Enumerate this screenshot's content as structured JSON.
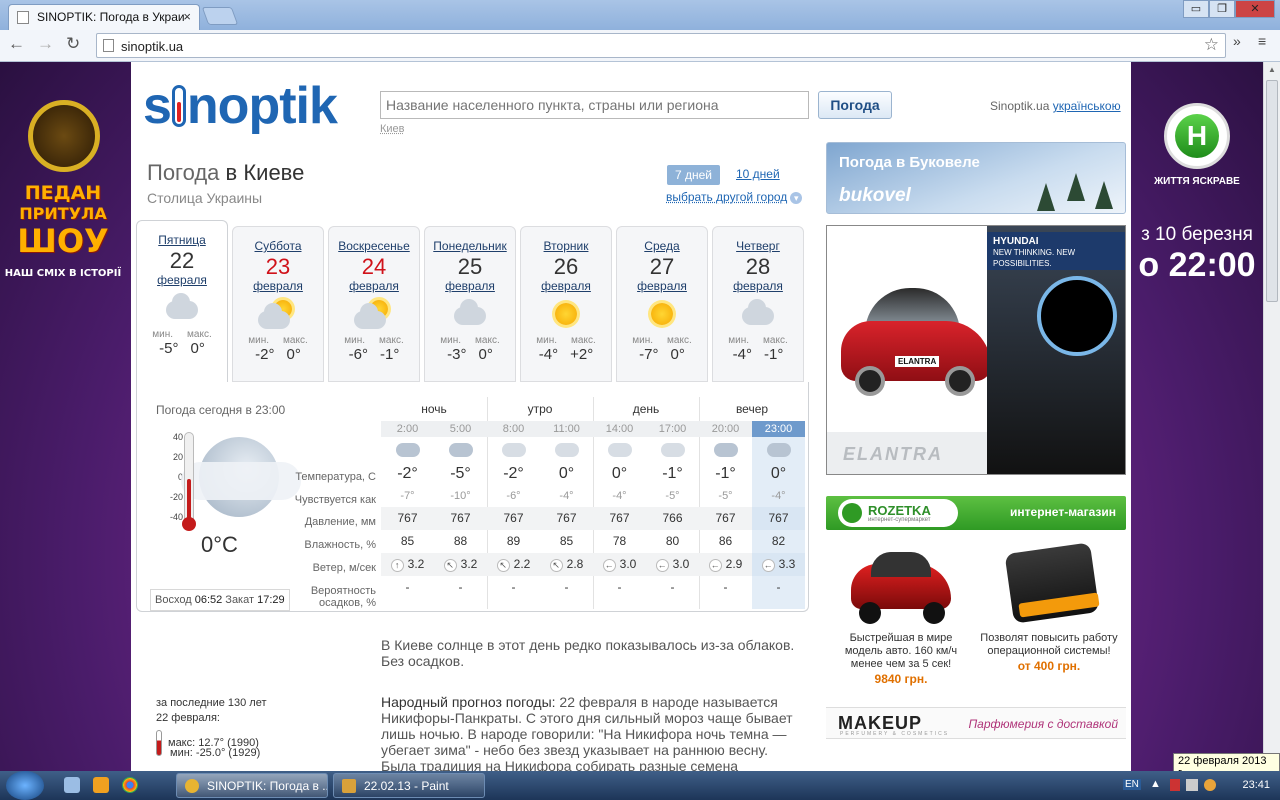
{
  "browser": {
    "tab_title": "SINOPTIK: Погода в Украи",
    "url": "sinoptik.ua",
    "window_buttons": [
      "▭",
      "❐",
      "✕"
    ]
  },
  "left_ad": {
    "title": "ПЕДАН ПРИТУЛА ШОУ",
    "line1": "ПЕДАН",
    "line2": "ПРИТУЛА",
    "line3": "ШОУ",
    "tagline": "НАШ СМІХ В ІСТОРІЇ"
  },
  "header": {
    "logo": "sinoptik",
    "search_placeholder": "Название населенного пункта, страны или региона",
    "search_button": "Погода",
    "search_hint": "Киев",
    "site_name": "Sinoptik.ua",
    "lang_link": "українською"
  },
  "title": {
    "lead": "Погода",
    "city": "в Киеве",
    "subtitle": "Столица Украины",
    "days7": "7 дней",
    "days10": "10 дней",
    "other_city": "выбрать другой город"
  },
  "days": [
    {
      "name": "Пятница",
      "day": "22",
      "month": "февраля",
      "icon": "cloudy",
      "min": "-5°",
      "max": "0°",
      "red": false
    },
    {
      "name": "Суббота",
      "day": "23",
      "month": "февраля",
      "icon": "sun-cloud",
      "min": "-2°",
      "max": "0°",
      "red": true
    },
    {
      "name": "Воскресенье",
      "day": "24",
      "month": "февраля",
      "icon": "sun-cloud",
      "min": "-6°",
      "max": "-1°",
      "red": true
    },
    {
      "name": "Понедельник",
      "day": "25",
      "month": "февраля",
      "icon": "cloudy",
      "min": "-3°",
      "max": "0°",
      "red": false
    },
    {
      "name": "Вторник",
      "day": "26",
      "month": "февраля",
      "icon": "sun",
      "min": "-4°",
      "max": "+2°",
      "red": false
    },
    {
      "name": "Среда",
      "day": "27",
      "month": "февраля",
      "icon": "sun",
      "min": "-7°",
      "max": "0°",
      "red": false
    },
    {
      "name": "Четверг",
      "day": "28",
      "month": "февраля",
      "icon": "cloudy",
      "min": "-4°",
      "max": "-1°",
      "red": false
    }
  ],
  "min_label": "мин.",
  "max_label": "макс.",
  "now": {
    "label": "Погода сегодня в 23:00",
    "temp": "0°C",
    "scale": [
      "40",
      "20",
      "0",
      "-20",
      "-40"
    ],
    "temp_value": 0,
    "sunrise_label": "Восход",
    "sunrise": "06:52",
    "sunset_label": "Закат",
    "sunset": "17:29"
  },
  "periods": [
    "ночь",
    "утро",
    "день",
    "вечер"
  ],
  "row_labels": {
    "temp": "Температура, С",
    "feels": "Чувствуется как",
    "pressure": "Давление, мм",
    "humidity": "Влажность, %",
    "wind": "Ветер, м/сек",
    "precip": "Вероятность осадков, %"
  },
  "hours": [
    {
      "time": "2:00",
      "temp": "-2°",
      "feels": "-7°",
      "pressure": "767",
      "humidity": "85",
      "wind_dir": "↑",
      "wind": "3.2",
      "precip": "-",
      "icon": "dark"
    },
    {
      "time": "5:00",
      "temp": "-5°",
      "feels": "-10°",
      "pressure": "767",
      "humidity": "88",
      "wind_dir": "↖",
      "wind": "3.2",
      "precip": "-",
      "icon": "dark"
    },
    {
      "time": "8:00",
      "temp": "-2°",
      "feels": "-6°",
      "pressure": "767",
      "humidity": "89",
      "wind_dir": "↖",
      "wind": "2.2",
      "precip": "-",
      "icon": "light"
    },
    {
      "time": "11:00",
      "temp": "0°",
      "feels": "-4°",
      "pressure": "767",
      "humidity": "85",
      "wind_dir": "↖",
      "wind": "2.8",
      "precip": "-",
      "icon": "light"
    },
    {
      "time": "14:00",
      "temp": "0°",
      "feels": "-4°",
      "pressure": "767",
      "humidity": "78",
      "wind_dir": "←",
      "wind": "3.0",
      "precip": "-",
      "icon": "light"
    },
    {
      "time": "17:00",
      "temp": "-1°",
      "feels": "-5°",
      "pressure": "766",
      "humidity": "80",
      "wind_dir": "←",
      "wind": "3.0",
      "precip": "-",
      "icon": "light"
    },
    {
      "time": "20:00",
      "temp": "-1°",
      "feels": "-5°",
      "pressure": "767",
      "humidity": "86",
      "wind_dir": "←",
      "wind": "2.9",
      "precip": "-",
      "icon": "dark"
    },
    {
      "time": "23:00",
      "temp": "0°",
      "feels": "-4°",
      "pressure": "767",
      "humidity": "82",
      "wind_dir": "←",
      "wind": "3.3",
      "precip": "-",
      "icon": "dark"
    }
  ],
  "description": "В Киеве солнце в этот день редко показывалось из-за облаков. Без осадков.",
  "folk": {
    "title": "Народный прогноз погоды:",
    "text": " 22 февраля в народе называется Никифоры-Панкраты. С этого дня сильный мороз чаще бывает лишь ночью. В народе говорили: \"На Никифора ночь темна — убегает зима\" - небо без звезд указывает на раннюю весну. Была традиция на Никифора собирать разные семена"
  },
  "history": {
    "line1": "за последние 130 лет",
    "line2": "22 февраля:",
    "max_label": "макс:",
    "max": "12.7° (1990)",
    "min_label": "мин:",
    "min": "-25.0° (1929)"
  },
  "bukovel": {
    "title": "Погода в Буковеле",
    "brand": "bukovel"
  },
  "hyundai": {
    "brand": "HYUNDAI",
    "slogan": "NEW THINKING. NEW POSSIBILITIES.",
    "badge": "ELANTRA",
    "model": "ELANTRA"
  },
  "rozetka": {
    "logo": "ROZETKA",
    "sub": "интернет-супермаркет",
    "shop": "интернет-магазин"
  },
  "products": [
    {
      "text": "Быстрейшая в мире модель авто. 160 км/ч менее чем за 5 сек!",
      "price": "9840 грн."
    },
    {
      "text": "Позволят повысить работу операционной системы!",
      "price": "от 400 грн."
    }
  ],
  "makeup": {
    "logo": "MAKEUP",
    "sub": "PERFUMERY & COSMETICS",
    "slogan": "Парфюмерия с доставкой"
  },
  "right_ad": {
    "logo": "Н",
    "slogan": "ЖИТТЯ ЯСКРАВЕ",
    "date": "з 10 березня",
    "time": "о 22:00"
  },
  "taskbar": {
    "chrome_item": "SINOPTIK: Погода в ...",
    "paint_item": "22.02.13 - Paint",
    "lang": "EN",
    "time": "23:41",
    "date_tooltip": "22 февраля 2013 г."
  }
}
